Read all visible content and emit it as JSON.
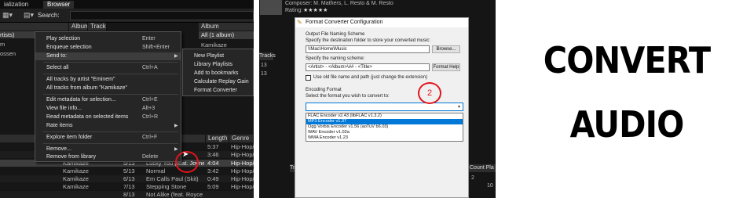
{
  "player": {
    "tabs": [
      "ialization",
      "Browser"
    ],
    "search_label": "Search:",
    "left_items": [
      "rtists)",
      "m",
      "ossen"
    ],
    "column_headers": [
      "Album",
      "Tracks"
    ],
    "album_panel": {
      "header": "Album",
      "items": [
        "All (1 album)",
        "Kamikaze"
      ]
    },
    "track_headers": {
      "length": "Length",
      "genre": "Genre"
    },
    "tracks": [
      {
        "album": "",
        "track": "",
        "title": "",
        "length": "5:37",
        "genre": "Hip-Hop/"
      },
      {
        "album": "",
        "track": "",
        "title": "",
        "length": "3:46",
        "genre": "Hip-Hop/"
      },
      {
        "album": "",
        "track": "",
        "title": "",
        "length": "4:04",
        "genre": "Hip-Hop/"
      },
      {
        "album": "Kamikaze",
        "track": "5/13",
        "title": "Normal",
        "length": "3:42",
        "genre": "Hip-Hop/"
      },
      {
        "album": "Kamikaze",
        "track": "6/13",
        "title": "Em Calls Paul (Skit)",
        "length": "0:49",
        "genre": "Hip-Hop/"
      },
      {
        "album": "Kamikaze",
        "track": "7/13",
        "title": "Stepping Stone",
        "length": "5:09",
        "genre": "Hip-Hop/"
      }
    ],
    "partial_rows": [
      "Kamikaze",
      "5/13",
      "Lucky You (feat. Joyne",
      "8/13",
      "Not Alike (feat. Royce"
    ]
  },
  "context_menu": {
    "items": [
      {
        "label": "Play selection",
        "shortcut": "Enter"
      },
      {
        "label": "Enqueue selection",
        "shortcut": "Shift+Enter"
      },
      {
        "label": "Send to:",
        "shortcut": "",
        "submenu": true
      },
      {
        "label": "Select all",
        "shortcut": "Ctrl+A"
      },
      {
        "label": "All tracks by artist \"Eminem\"",
        "shortcut": ""
      },
      {
        "label": "All tracks from album \"Kamikaze\"",
        "shortcut": ""
      },
      {
        "label": "Edit metadata for selection...",
        "shortcut": "Ctrl+E"
      },
      {
        "label": "View file info...",
        "shortcut": "Alt+3"
      },
      {
        "label": "Read metadata on selected items",
        "shortcut": "Ctrl+R"
      },
      {
        "label": "Rate items",
        "shortcut": "",
        "submenu": true
      },
      {
        "label": "Explore item folder",
        "shortcut": "Ctrl+F"
      },
      {
        "label": "Remove...",
        "shortcut": "",
        "submenu": true
      },
      {
        "label": "Remove from library",
        "shortcut": "Delete"
      }
    ],
    "sendto_submenu": [
      "New Playlist",
      "Library Playlists",
      "Add to bookmarks",
      "Calculate Replay Gain",
      "Format Converter"
    ]
  },
  "panel2_background": {
    "composer": "Composer: M. Mathers, L. Resto & M. Resto",
    "rating_label": "Rating:",
    "rating_stars": "★★★★★",
    "right_col": [
      "Tracks",
      "13",
      "13"
    ],
    "tracks_label": "Tr",
    "count_header": "Count",
    "play_header": "Pla",
    "bottom_numbers": [
      "2",
      "10"
    ]
  },
  "dialog": {
    "title": "Format Converter Configuration",
    "section1": "Output File Naming Scheme",
    "dest_label": "Specify the destination folder to store your converted music:",
    "dest_value": "\\\\Mac\\Home\\Music",
    "browse_button": "Browse...",
    "naming_label": "Specify the naming scheme:",
    "naming_value": "<Artist> - <Album>\\## - <Title>",
    "format_help_button": "Format Help",
    "checkbox_label": "Use old file name and path (just change the extension)",
    "section2": "Encoding Format",
    "format_label": "Select the format you wish to convert to:",
    "encoders": [
      "FLAC Encoder v2.43 (libFLAC v1.3.2)",
      "MP3 Encoder v1.37",
      "Ogg Vorbis Encoder v1.56 (aoTuV b6.03)",
      "WAV Encoder v1.02a",
      "WMA Encoder v1.23"
    ],
    "selected_encoder_index": 1,
    "step_marker": "2"
  },
  "headline": {
    "line1": "CONVERT",
    "line2": "AUDIO"
  },
  "colors": {
    "annotation_red": "#e2141b",
    "selection_blue": "#0078d7"
  }
}
